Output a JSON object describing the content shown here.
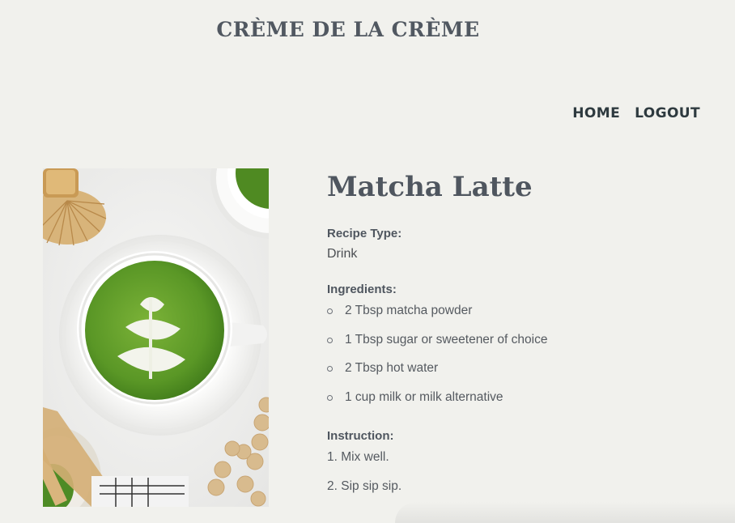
{
  "site": {
    "title": "CRÈME DE LA CRÈME"
  },
  "nav": {
    "home": "HOME",
    "logout": "LOGOUT"
  },
  "recipe": {
    "title": "Matcha Latte",
    "image_alt": "Matcha Latte",
    "type_label": "Recipe Type:",
    "type_value": "Drink",
    "ingredients_label": "Ingredients:",
    "ingredients": [
      "2 Tbsp matcha powder",
      "1 Tbsp sugar or sweetener of choice",
      "2 Tbsp hot water",
      "1 cup milk or milk alternative"
    ],
    "instruction_label": "Instruction:",
    "instructions": [
      "1. Mix well.",
      "2. Sip sip sip."
    ]
  },
  "colors": {
    "background": "#f1f1ed",
    "heading": "#4f565f",
    "nav": "#2e3a3f",
    "matcha": "#5f9a2a"
  }
}
